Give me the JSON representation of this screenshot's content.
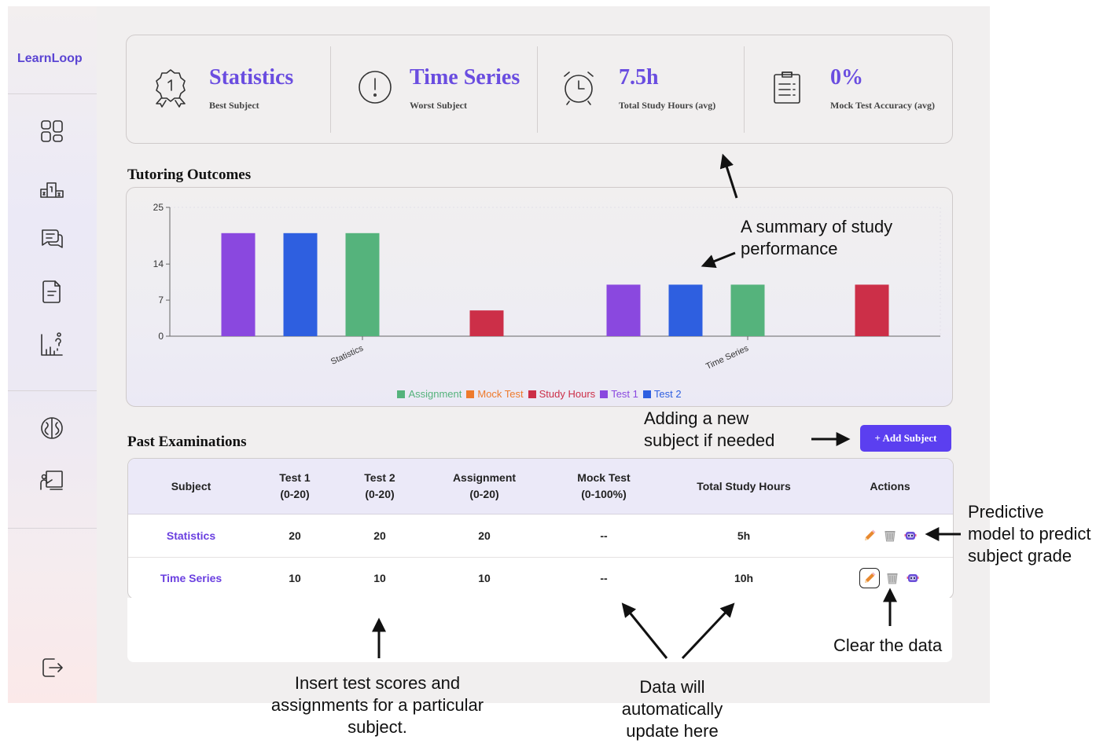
{
  "brand": "LearnLoop",
  "sidebar": {
    "icons": [
      "dashboard-icon",
      "leaderboard-icon",
      "chat-icon",
      "document-icon",
      "progress-chart-icon",
      "brain-icon",
      "teacher-board-icon",
      "logout-icon"
    ]
  },
  "summary": [
    {
      "value": "Statistics",
      "label": "Best Subject",
      "icon": "award-badge-icon"
    },
    {
      "value": "Time Series",
      "label": "Worst Subject",
      "icon": "alert-circle-icon"
    },
    {
      "value": "7.5h",
      "label": "Total Study Hours (avg)",
      "icon": "alarm-clock-icon"
    },
    {
      "value": "0%",
      "label": "Mock Test Accuracy (avg)",
      "icon": "clipboard-icon"
    }
  ],
  "outcomes_title": "Tutoring Outcomes",
  "chart_data": {
    "type": "bar",
    "categories": [
      "Statistics",
      "Time Series"
    ],
    "series": [
      {
        "name": "Test 1",
        "color": "#8a48df",
        "values": [
          20,
          10
        ]
      },
      {
        "name": "Test 2",
        "color": "#2e5fe0",
        "values": [
          20,
          10
        ]
      },
      {
        "name": "Assignment",
        "color": "#55b37c",
        "values": [
          20,
          10
        ]
      },
      {
        "name": "Mock Test",
        "color": "#ee7a2c",
        "values": [
          0,
          0
        ]
      },
      {
        "name": "Study Hours",
        "color": "#cc2f48",
        "values": [
          5,
          10
        ]
      }
    ],
    "legend_order": [
      {
        "name": "Assignment",
        "color": "#55b37c"
      },
      {
        "name": "Mock Test",
        "color": "#ee7a2c"
      },
      {
        "name": "Study Hours",
        "color": "#cc2f48"
      },
      {
        "name": "Test 1",
        "color": "#8a48df"
      },
      {
        "name": "Test 2",
        "color": "#2e5fe0"
      }
    ],
    "yticks": [
      0,
      7,
      14,
      25
    ],
    "ylim": [
      0,
      25
    ],
    "legend_position": "bottom",
    "grid": false
  },
  "exams_title": "Past Examinations",
  "add_button": "+ Add Subject",
  "table": {
    "headers": [
      "Subject",
      "Test 1\n(0-20)",
      "Test 2\n(0-20)",
      "Assignment\n(0-20)",
      "Mock Test\n(0-100%)",
      "Total Study Hours",
      "Actions"
    ],
    "rows": [
      {
        "subject": "Statistics",
        "test1": "20",
        "test2": "20",
        "assignment": "20",
        "mock": "--",
        "hours": "5h"
      },
      {
        "subject": "Time Series",
        "test1": "10",
        "test2": "10",
        "assignment": "10",
        "mock": "--",
        "hours": "10h"
      }
    ],
    "action_icons": [
      "edit-pencil-icon",
      "trash-bin-icon",
      "robot-predict-icon"
    ]
  },
  "annotations": {
    "summary": "A summary of study\nperformance",
    "add": "Adding a new\nsubject if needed",
    "predict": "Predictive\nmodel to predict\nsubject grade",
    "clear": "Clear the data",
    "insert": "Insert test scores and\nassignments for a particular\nsubject.",
    "auto": "Data will\nautomatically\nupdate here"
  }
}
